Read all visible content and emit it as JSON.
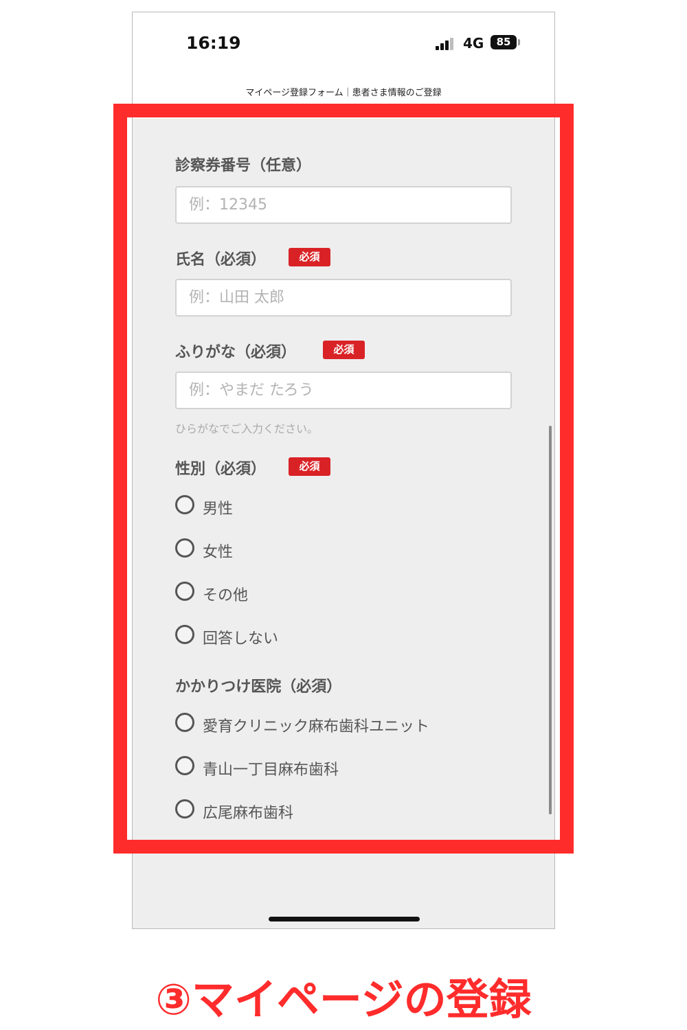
{
  "status_bar": {
    "time": "16:19",
    "network": "4G",
    "battery": "85"
  },
  "header": {
    "title": "マイページ登録フォーム｜患者さま情報のご登録"
  },
  "form": {
    "required_badge": "必須",
    "card_number": {
      "label": "診察券番号（任意）",
      "placeholder": "例：12345",
      "value": ""
    },
    "name": {
      "label": "氏名（必須）",
      "placeholder": "例：山田 太郎",
      "value": ""
    },
    "furigana": {
      "label": "ふりがな（必須）",
      "placeholder": "例：やまだ たろう",
      "value": "",
      "help": "ひらがなでご入力ください。"
    },
    "gender": {
      "label": "性別（必須）",
      "options": [
        "男性",
        "女性",
        "その他",
        "回答しない"
      ]
    },
    "clinic": {
      "label": "かかりつけ医院（必須）",
      "options": [
        "愛育クリニック麻布歯科ユニット",
        "青山一丁目麻布歯科",
        "広尾麻布歯科"
      ]
    }
  },
  "caption": {
    "text": "③マイページの登録"
  },
  "colors": {
    "highlight": "#ff2c2c",
    "badge": "#d92226",
    "form_background": "#eeeeee"
  },
  "icons": {
    "radio": "radio-unchecked-icon",
    "signal": "signal-bars-icon",
    "battery": "battery-icon"
  }
}
